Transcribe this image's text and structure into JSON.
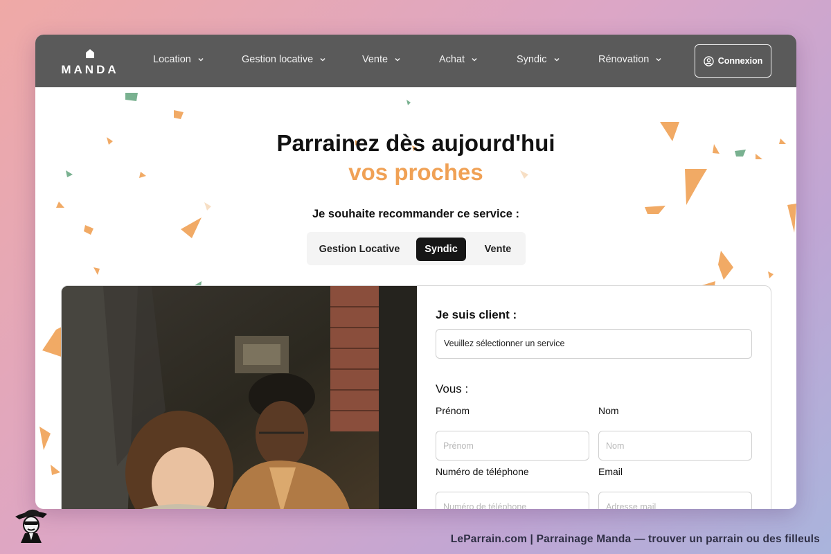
{
  "colors": {
    "accent_orange": "#f0a155",
    "header_bg": "#5a5a5a",
    "active_tab": "#161616",
    "confetti_green": "#6aa884"
  },
  "header": {
    "logo_text": "MANDA",
    "nav": [
      {
        "label": "Location",
        "icon": "chevron-down-icon"
      },
      {
        "label": "Gestion locative",
        "icon": "chevron-down-icon"
      },
      {
        "label": "Vente",
        "icon": "chevron-down-icon"
      },
      {
        "label": "Achat",
        "icon": "chevron-down-icon"
      },
      {
        "label": "Syndic",
        "icon": "chevron-down-icon"
      },
      {
        "label": "Rénovation",
        "icon": "chevron-down-icon"
      }
    ],
    "login_label": "Connexion",
    "login_icon": "user-circle-icon"
  },
  "hero": {
    "title": "Parrainez dès aujourd'hui",
    "subtitle": "vos proches",
    "question": "Je souhaite recommander ce service :",
    "tabs": [
      {
        "label": "Gestion Locative",
        "active": false
      },
      {
        "label": "Syndic",
        "active": true
      },
      {
        "label": "Vente",
        "active": false
      }
    ]
  },
  "form": {
    "client_heading": "Je suis client :",
    "service_select_value": "Veuillez sélectionner un service",
    "vous_heading": "Vous :",
    "fields": {
      "prenom": {
        "label": "Prénom",
        "placeholder": "Prénom"
      },
      "nom": {
        "label": "Nom",
        "placeholder": "Nom"
      },
      "telephone": {
        "label": "Numéro de téléphone",
        "placeholder": "Numéro de téléphone"
      },
      "email": {
        "label": "Email",
        "placeholder": "Adresse mail"
      }
    }
  },
  "footer": {
    "caption": "LeParrain.com | Parrainage Manda — trouver un parrain ou des filleuls"
  }
}
